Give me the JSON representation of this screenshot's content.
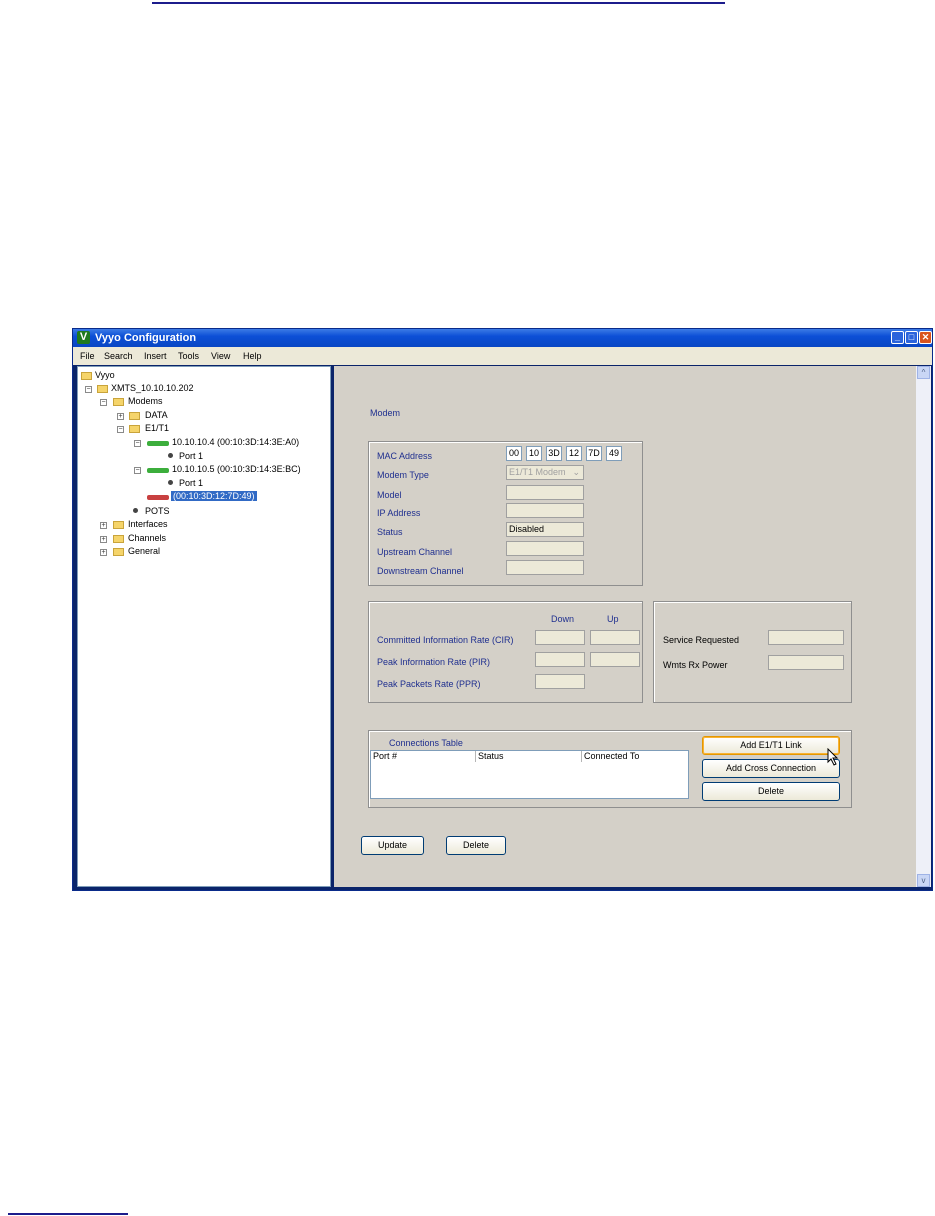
{
  "window": {
    "title": "Vyyo Configuration",
    "logo": "V"
  },
  "menu": [
    "File",
    "Search",
    "Insert",
    "Tools",
    "View",
    "Help"
  ],
  "tree": {
    "root": "Vyyo",
    "xmts": "XMTS_10.10.10.202",
    "modems": "Modems",
    "data": "DATA",
    "e1t1": "E1/T1",
    "modem1": "10.10.10.4 (00:10:3D:14:3E:A0)",
    "modem1_port": "Port 1",
    "modem2": "10.10.10.5 (00:10:3D:14:3E:BC)",
    "modem2_port": "Port 1",
    "modem3": "(00:10:3D:12:7D:49)",
    "pots": "POTS",
    "interfaces": "Interfaces",
    "channels": "Channels",
    "general": "General"
  },
  "form": {
    "section_title": "Modem",
    "mac_label": "MAC Address",
    "mac": [
      "00",
      "10",
      "3D",
      "12",
      "7D",
      "49"
    ],
    "modem_type_label": "Modem Type",
    "modem_type_value": "E1/T1 Modem",
    "model_label": "Model",
    "ip_label": "IP Address",
    "status_label": "Status",
    "status_value": "Disabled",
    "upstream_label": "Upstream Channel",
    "downstream_label": "Downstream Channel",
    "down_header": "Down",
    "up_header": "Up",
    "cir_label": "Committed Information Rate (CIR)",
    "pir_label": "Peak Information Rate (PIR)",
    "ppr_label": "Peak Packets Rate (PPR)",
    "service_label": "Service Requested",
    "wmts_label": "Wmts Rx Power",
    "connections_title": "Connections Table",
    "col_port": "Port #",
    "col_status": "Status",
    "col_connected": "Connected To",
    "add_link": "Add E1/T1 Link",
    "add_cross": "Add Cross Connection",
    "delete_conn": "Delete",
    "update": "Update",
    "delete": "Delete"
  },
  "colors": {
    "title_bar": "#0846c4",
    "panel": "#d4d0c8",
    "label_blue": "#1f2f8f",
    "selection": "#316ac5"
  }
}
